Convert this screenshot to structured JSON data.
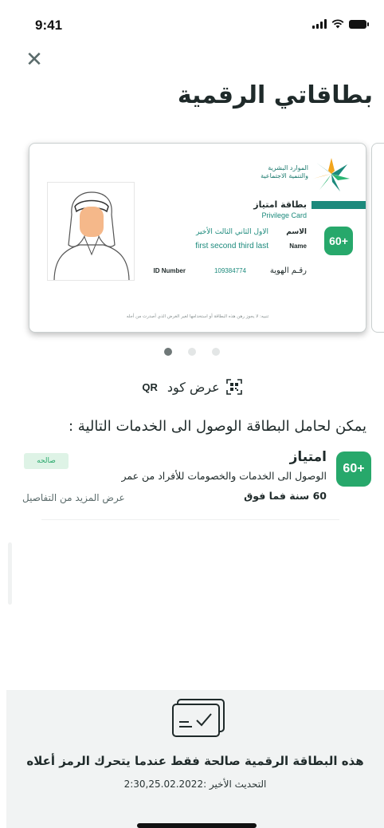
{
  "status": {
    "time": "9:41"
  },
  "title": "بطاقاتي الرقمية",
  "card": {
    "ministry_line1": "الموارد البشرية",
    "ministry_line2": "والتنمية الاجتماعية",
    "type_ar": "بطاقة امتياز",
    "type_en": "Privilege Card",
    "badge": "60+",
    "name_label_ar": "الاسم",
    "name_label_en": "Name",
    "name_ar": "الاول الثاني الثالث الأخير",
    "name_en": "first second third last",
    "id_label_ar": "رقـم الهوية",
    "id_number": "109384774",
    "id_label_en": "ID Number",
    "footer_note": "تنبيه: لا يجوز رهن هذه البطاقة أو استخدامها لغير الغرض الذي أصدرت من أجله"
  },
  "carousel": {
    "active_index": 0,
    "count": 3
  },
  "qr": {
    "label_ar": "عرض كود",
    "label_en": "QR"
  },
  "services": {
    "heading": "يمكن لحامل البطاقة الوصول الى الخدمات التالية :",
    "items": [
      {
        "badge": "60+",
        "title": "امتياز",
        "description": "الوصول الى الخدمات والخصومات للأفراد من عمر",
        "age": "60 سنة فما فوق",
        "status": "صالحه",
        "more": "عرض المزيد من التفاصيل"
      }
    ]
  },
  "footer": {
    "note": "هذه البطاقة الرقمية صالحة فقط عندما يتحرك الرمز أعلاه",
    "last_update": "التحديث الأخير :2:30,25.02.2022"
  },
  "colors": {
    "brand": "#1c8a7c",
    "badge": "#27a86b",
    "valid_bg": "#def3e6"
  }
}
